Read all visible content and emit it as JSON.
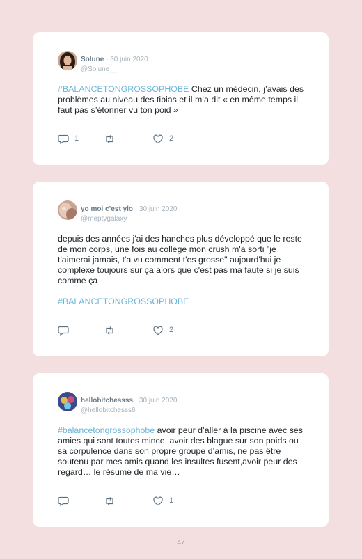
{
  "tweets": [
    {
      "name": "Solune",
      "sep": " · ",
      "date": "30 juin 2020",
      "handle": "@Solune__",
      "hashtag": "#BALANCETONGROSSOPHOBE",
      "body": " Chez un médecin, j’avais des problèmes au niveau des tibias et il m’a dit « en même temps il faut pas s’étonner vu ton poid »",
      "replies": "1",
      "retweets": "",
      "likes": "2"
    },
    {
      "name": "yo moi c’est ylo",
      "sep": " · ",
      "date": "30 juin 2020",
      "handle": "@meptygalaxy",
      "body": "depuis des années j'ai des hanches plus développé que le reste de mon corps, une fois au collège mon crush m'a sorti \"je t'aimerai jamais, t'a vu comment t'es grosse\" aujourd'hui je complexe toujours sur ça alors que c'est pas ma faute si je suis comme ça",
      "hashtag": "#BALANCETONGROSSOPHOBE",
      "replies": "",
      "retweets": "",
      "likes": "2"
    },
    {
      "name": "hellobitchessss",
      "sep": " · ",
      "date": "30 juin 2020",
      "handle": "@hellobitchesss6",
      "hashtag": "#balancetongrossophobe",
      "body": " avoir peur d’aller à la piscine avec ses amies qui sont toutes mince, avoir des blague sur son poids ou sa corpulence dans son propre groupe d’amis, ne pas être soutenu par mes amis quand les insultes fusent,avoir peur des regard… le résumé de ma vie…",
      "replies": "",
      "retweets": "",
      "likes": "1"
    }
  ],
  "icons": {
    "reply": "reply-icon",
    "retweet": "retweet-icon",
    "like": "heart-icon"
  },
  "colors": {
    "background": "#f3dfe0",
    "card": "#ffffff",
    "hashtag": "#6ab7d9",
    "name": "#6a7b88",
    "muted": "#a7b3bc"
  },
  "page_number": "47"
}
